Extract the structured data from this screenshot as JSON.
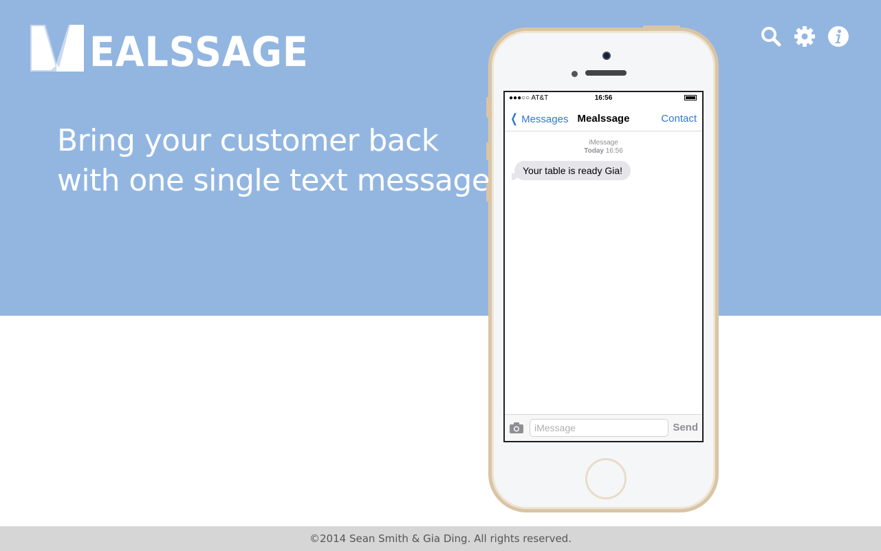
{
  "brand": {
    "name": "EALSSAGE",
    "logo_letter": "M"
  },
  "hero": {
    "tagline_line1": "Bring your customer back",
    "tagline_line2": "with one single text message."
  },
  "top_icons": [
    "search-icon",
    "gear-icon",
    "info-icon"
  ],
  "colors": {
    "hero_bg": "#93b6e1",
    "footer_bg": "#d6d6d6",
    "ios_blue": "#2f77d0"
  },
  "phone": {
    "status": {
      "carrier": "●●●○○ AT&T",
      "time": "16:56"
    },
    "nav": {
      "back_label": "Messages",
      "title": "Mealssage",
      "contact_label": "Contact"
    },
    "thread": {
      "service": "iMessage",
      "day": "Today",
      "time": "16:56",
      "messages": [
        "Your table is ready Gia!"
      ]
    },
    "input": {
      "placeholder": "iMessage",
      "send_label": "Send"
    }
  },
  "footer": {
    "copyright": "©2014 Sean Smith & Gia Ding. All rights reserved."
  }
}
